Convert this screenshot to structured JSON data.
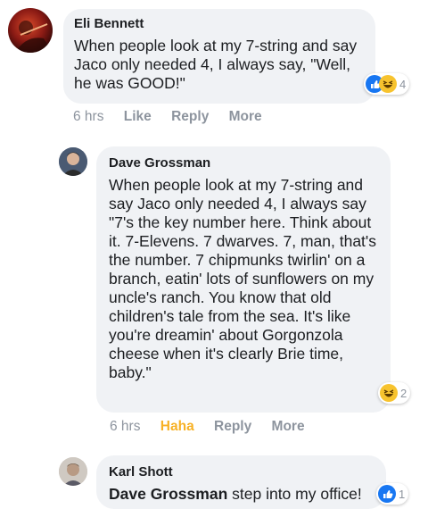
{
  "comments": [
    {
      "author": "Eli Bennett",
      "text": "When people look at my 7-string and say Jaco only needed 4, I always say, \"Well, he was GOOD!\"",
      "reaction_count": "4",
      "time": "6 hrs",
      "actions": [
        "Like",
        "Reply",
        "More"
      ]
    },
    {
      "author": "Dave Grossman",
      "text": "When people look at my 7-string and say Jaco only needed 4, I always say \"7's the key number here. Think about it. 7-Elevens. 7 dwarves. 7, man, that's the number. 7 chipmunks twirlin' on a branch, eatin' lots of sunflowers on my uncle's ranch. You know that old children's tale from the sea. It's like you're dreamin' about Gorgonzola cheese when it's clearly Brie time, baby.\"",
      "reaction_count": "2",
      "time": "6 hrs",
      "actions": [
        "Haha",
        "Reply",
        "More"
      ]
    },
    {
      "author": "Karl Shott",
      "mention": "Dave Grossman",
      "text": " step into my office!",
      "reaction_count": "1"
    }
  ],
  "colors": {
    "bubble": "#f0f2f5",
    "like_blue": "#1877f2",
    "haha_yellow": "#f7b125",
    "meta_gray": "#8d949e"
  },
  "icons": [
    "like-icon",
    "haha-icon"
  ]
}
